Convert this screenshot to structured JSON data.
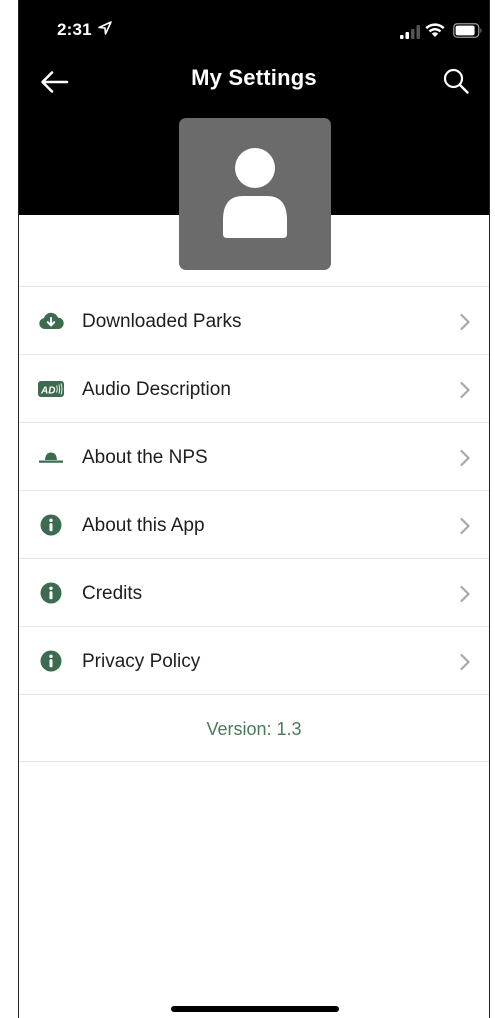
{
  "status_bar": {
    "time": "2:31"
  },
  "nav": {
    "title": "My Settings",
    "back_icon": "arrow-left-icon",
    "search_icon": "search-icon"
  },
  "profile": {
    "avatar_icon": "user-icon"
  },
  "menu": {
    "items": [
      {
        "label": "Downloaded Parks",
        "icon": "cloud-download-icon"
      },
      {
        "label": "Audio Description",
        "icon": "audio-description-icon"
      },
      {
        "label": "About the NPS",
        "icon": "ranger-hat-icon"
      },
      {
        "label": "About this App",
        "icon": "info-icon"
      },
      {
        "label": "Credits",
        "icon": "info-icon"
      },
      {
        "label": "Privacy Policy",
        "icon": "info-icon"
      }
    ]
  },
  "version": {
    "text": "Version: 1.3"
  },
  "colors": {
    "header_bg": "#000000",
    "accent_green": "#3d6b4f",
    "chevron": "#a8a8a8",
    "avatar_bg": "#6b6b6b",
    "version_text": "#4a7a5a"
  }
}
